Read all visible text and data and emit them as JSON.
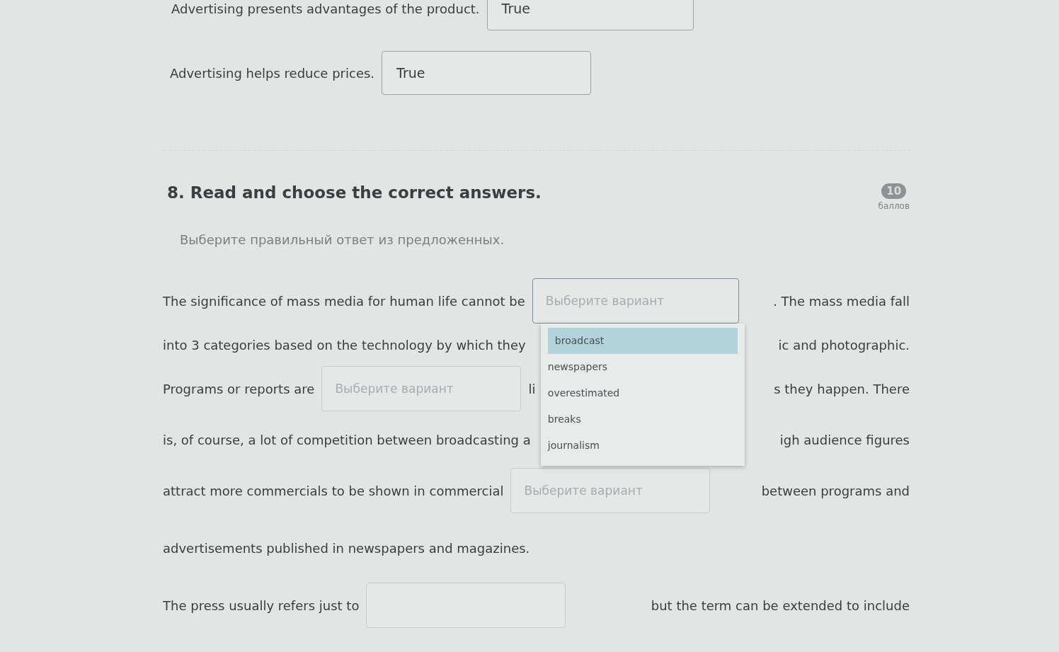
{
  "statements": [
    {
      "text": "Advertising presents advantages of the product.",
      "answer": "True"
    },
    {
      "text": "Advertising helps reduce prices.",
      "answer": "True"
    }
  ],
  "question": {
    "title": "8. Read and choose the correct answers.",
    "points": "10",
    "points_label": "баллов",
    "instruction": "Выберите правильный ответ из предложенных.",
    "lines": [
      {
        "segments": [
          {
            "kind": "text",
            "text": "The significance of mass media for human life cannot be"
          },
          {
            "kind": "select",
            "placeholder": "Выберите вариант",
            "open": true
          },
          {
            "kind": "text",
            "text": ". The mass media fall"
          }
        ]
      },
      {
        "segments": [
          {
            "kind": "text",
            "text": "into 3 categories based on the technology by which they"
          },
          {
            "kind": "text",
            "text": "ic and photographic."
          }
        ]
      },
      {
        "segments": [
          {
            "kind": "text",
            "text": "Programs or reports are"
          },
          {
            "kind": "select",
            "placeholder": "Выберите вариант",
            "open": false
          },
          {
            "kind": "text",
            "text": "li"
          },
          {
            "kind": "text",
            "text": "s they happen. There"
          }
        ]
      },
      {
        "segments": [
          {
            "kind": "text",
            "text": "is, of course, a lot of competition between broadcasting a"
          },
          {
            "kind": "text",
            "text": "igh audience figures"
          }
        ]
      },
      {
        "segments": [
          {
            "kind": "text",
            "text": "attract more commercials to be shown in commercial"
          },
          {
            "kind": "select",
            "placeholder": "Выберите вариант",
            "open": false
          },
          {
            "kind": "text",
            "text": "between programs and"
          }
        ]
      },
      {
        "segments": [
          {
            "kind": "text",
            "text": "advertisements published in newspapers and magazines."
          }
        ]
      },
      {
        "segments": [
          {
            "kind": "text",
            "text": "The press usually refers just to"
          },
          {
            "kind": "select",
            "open": false
          },
          {
            "kind": "text",
            "text": "but the term can be extended to include"
          }
        ]
      }
    ],
    "dropdown": {
      "options": [
        {
          "label": "broadcast",
          "selected": true
        },
        {
          "label": "newspapers",
          "selected": false
        },
        {
          "label": "overestimated",
          "selected": false
        },
        {
          "label": "breaks",
          "selected": false
        },
        {
          "label": "journalism",
          "selected": false
        }
      ]
    }
  }
}
